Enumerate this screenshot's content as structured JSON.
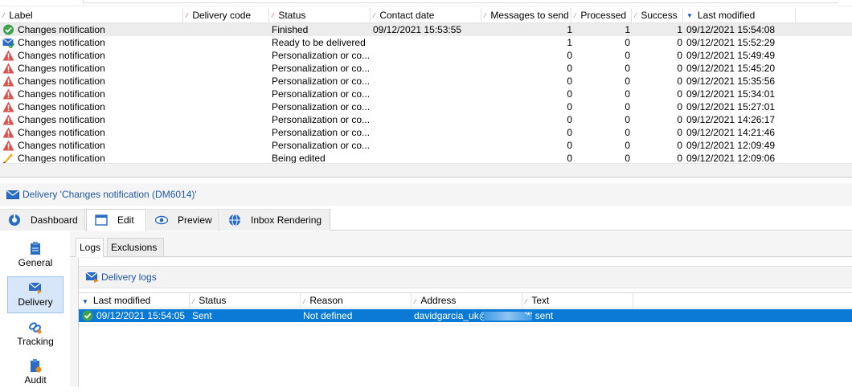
{
  "grid": {
    "columns": {
      "label": "Label",
      "delivery_code": "Delivery code",
      "status": "Status",
      "contact_date": "Contact date",
      "messages_to_send": "Messages to send",
      "processed": "Processed",
      "success": "Success",
      "last_modified": "Last modified"
    },
    "rows": [
      {
        "icon": "check-circle-icon",
        "label": "Changes notification",
        "code": "",
        "status": "Finished",
        "contact_date": "09/12/2021 15:53:55",
        "to_send": "1",
        "processed": "1",
        "success": "1",
        "modified": "09/12/2021 15:54:08"
      },
      {
        "icon": "envelope-ready-icon",
        "label": "Changes notification",
        "code": "",
        "status": "Ready to be delivered",
        "contact_date": "",
        "to_send": "1",
        "processed": "0",
        "success": "0",
        "modified": "09/12/2021 15:52:29"
      },
      {
        "icon": "warning-icon",
        "label": "Changes notification",
        "code": "",
        "status": "Personalization or co...",
        "contact_date": "",
        "to_send": "0",
        "processed": "0",
        "success": "0",
        "modified": "09/12/2021 15:49:49"
      },
      {
        "icon": "warning-icon",
        "label": "Changes notification",
        "code": "",
        "status": "Personalization or co...",
        "contact_date": "",
        "to_send": "0",
        "processed": "0",
        "success": "0",
        "modified": "09/12/2021 15:45:20"
      },
      {
        "icon": "warning-icon",
        "label": "Changes notification",
        "code": "",
        "status": "Personalization or co...",
        "contact_date": "",
        "to_send": "0",
        "processed": "0",
        "success": "0",
        "modified": "09/12/2021 15:35:56"
      },
      {
        "icon": "warning-icon",
        "label": "Changes notification",
        "code": "",
        "status": "Personalization or co...",
        "contact_date": "",
        "to_send": "0",
        "processed": "0",
        "success": "0",
        "modified": "09/12/2021 15:34:01"
      },
      {
        "icon": "warning-icon",
        "label": "Changes notification",
        "code": "",
        "status": "Personalization or co...",
        "contact_date": "",
        "to_send": "0",
        "processed": "0",
        "success": "0",
        "modified": "09/12/2021 15:27:01"
      },
      {
        "icon": "warning-icon",
        "label": "Changes notification",
        "code": "",
        "status": "Personalization or co...",
        "contact_date": "",
        "to_send": "0",
        "processed": "0",
        "success": "0",
        "modified": "09/12/2021 14:26:17"
      },
      {
        "icon": "warning-icon",
        "label": "Changes notification",
        "code": "",
        "status": "Personalization or co...",
        "contact_date": "",
        "to_send": "0",
        "processed": "0",
        "success": "0",
        "modified": "09/12/2021 14:21:46"
      },
      {
        "icon": "warning-icon",
        "label": "Changes notification",
        "code": "",
        "status": "Personalization or co...",
        "contact_date": "",
        "to_send": "0",
        "processed": "0",
        "success": "0",
        "modified": "09/12/2021 12:09:49"
      },
      {
        "icon": "pencil-icon",
        "label": "Changes notification",
        "code": "",
        "status": "Being edited",
        "contact_date": "",
        "to_send": "0",
        "processed": "0",
        "success": "0",
        "modified": "09/12/2021 12:09:06"
      }
    ]
  },
  "delivery": {
    "title": "Delivery 'Changes notification (DM6014)'"
  },
  "tabs": [
    {
      "label": "Dashboard",
      "icon": "dashboard-icon"
    },
    {
      "label": "Edit",
      "icon": "edit-window-icon"
    },
    {
      "label": "Preview",
      "icon": "eye-icon"
    },
    {
      "label": "Inbox Rendering",
      "icon": "globe-icon"
    }
  ],
  "sidebar": [
    {
      "label": "General",
      "icon": "general-icon"
    },
    {
      "label": "Delivery",
      "icon": "delivery-envelope-icon"
    },
    {
      "label": "Tracking",
      "icon": "tracking-link-icon"
    },
    {
      "label": "Audit",
      "icon": "audit-icon"
    }
  ],
  "subtabs": [
    "Logs",
    "Exclusions"
  ],
  "logs": {
    "toolbar_label": "Delivery logs",
    "columns": {
      "last_modified": "Last modified",
      "status": "Status",
      "reason": "Reason",
      "address": "Address",
      "text": "Text"
    },
    "row": {
      "last_modified": "09/12/2021 15:54:05",
      "status": "Sent",
      "reason": "Not defined",
      "address": "davidgarcia_uk@",
      "text": "'*' sent"
    }
  },
  "colors": {
    "link_blue": "#1f57a6",
    "selected_row": "#0a7ad6",
    "warning_red": "#d9534f",
    "success_green": "#3fa34d"
  }
}
